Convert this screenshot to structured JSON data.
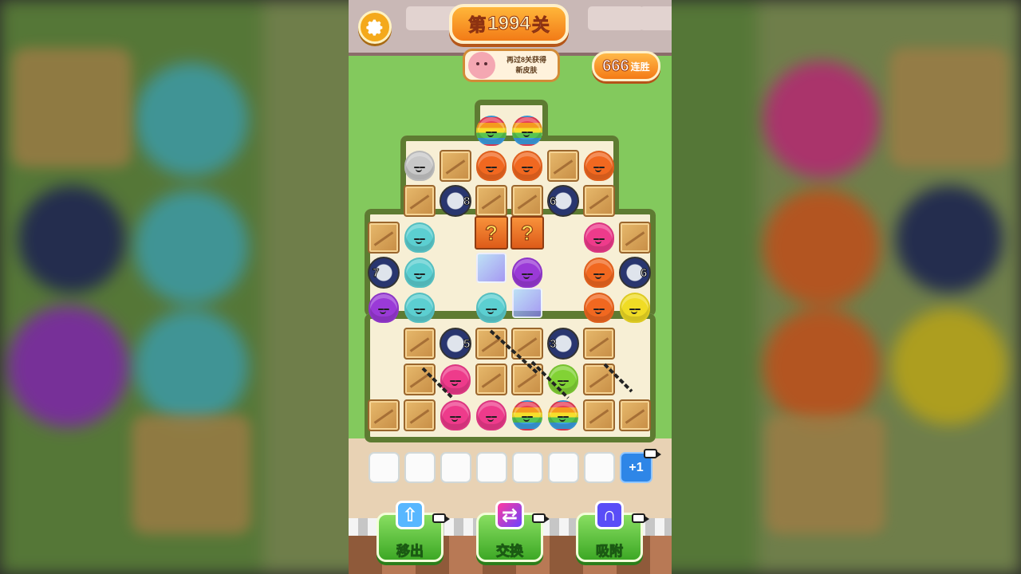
{
  "header": {
    "level_prefix": "第",
    "level_number": "1994",
    "level_suffix": "关",
    "reward_line1": "再过8关获得",
    "reward_line2": "新皮肤",
    "streak_number": "666",
    "streak_label": "连胜"
  },
  "board": {
    "counters": [
      "8",
      "6",
      "7",
      "6",
      "5",
      "3"
    ],
    "mystery_symbol": "?"
  },
  "tray": {
    "slot_count": 7,
    "extra_button": "+1"
  },
  "tools": [
    {
      "label": "移出",
      "icon": "move-out-icon",
      "color": "#3da825"
    },
    {
      "label": "交换",
      "icon": "swap-icon",
      "color": "#3da825"
    },
    {
      "label": "吸附",
      "icon": "magnet-icon",
      "color": "#3da825"
    }
  ],
  "colors": {
    "orange": "#f16820",
    "teal": "#5ccfd1",
    "purple": "#9a3ad7",
    "pink": "#ee3b8b",
    "yellow": "#f0dc25",
    "green": "#82d235"
  }
}
